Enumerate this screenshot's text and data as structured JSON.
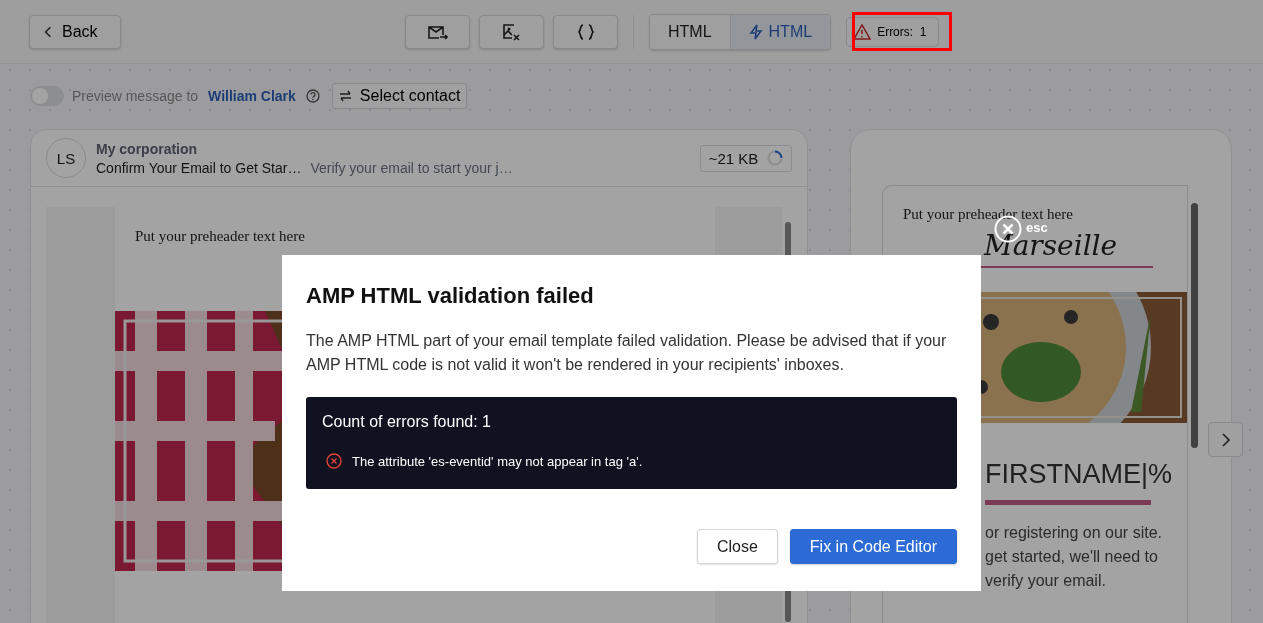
{
  "toolbar": {
    "back": "Back",
    "view_tabs": [
      {
        "label": "HTML",
        "kind": "plain",
        "selected": false
      },
      {
        "label": "HTML",
        "kind": "amp",
        "selected": true
      }
    ],
    "errors": {
      "label": "Errors:",
      "count": "1"
    }
  },
  "preview": {
    "enabled": false,
    "label": "Preview message to",
    "contact": "William Clark",
    "button": "Select contact"
  },
  "message": {
    "avatar": "LS",
    "sender": "My corporation",
    "subject": "Confirm Your Email to Get Star…",
    "preheader": "Verify your email to start your j…",
    "size": "~21 KB",
    "body_preheader": "Put your preheader text here"
  },
  "mobile_preview": {
    "preheader": "Put your preheader text here",
    "logo": "Marseille",
    "greeting": "FIRSTNAME|%",
    "lines": [
      "or registering on our site.",
      "get started, we'll need to",
      "verify your email."
    ]
  },
  "dialog": {
    "close_hint": "esc",
    "title": "AMP HTML validation failed",
    "text": "The AMP HTML part of your email template failed validation. Please be advised that if your AMP HTML code is not valid it won't be rendered in your recipients' inboxes.",
    "errors_heading": "Count of errors found: 1",
    "errors": [
      "The attribute 'es-eventid' may not appear in tag 'a'."
    ],
    "buttons": [
      {
        "label": "Close",
        "kind": "secondary"
      },
      {
        "label": "Fix in Code Editor",
        "kind": "primary"
      }
    ]
  }
}
